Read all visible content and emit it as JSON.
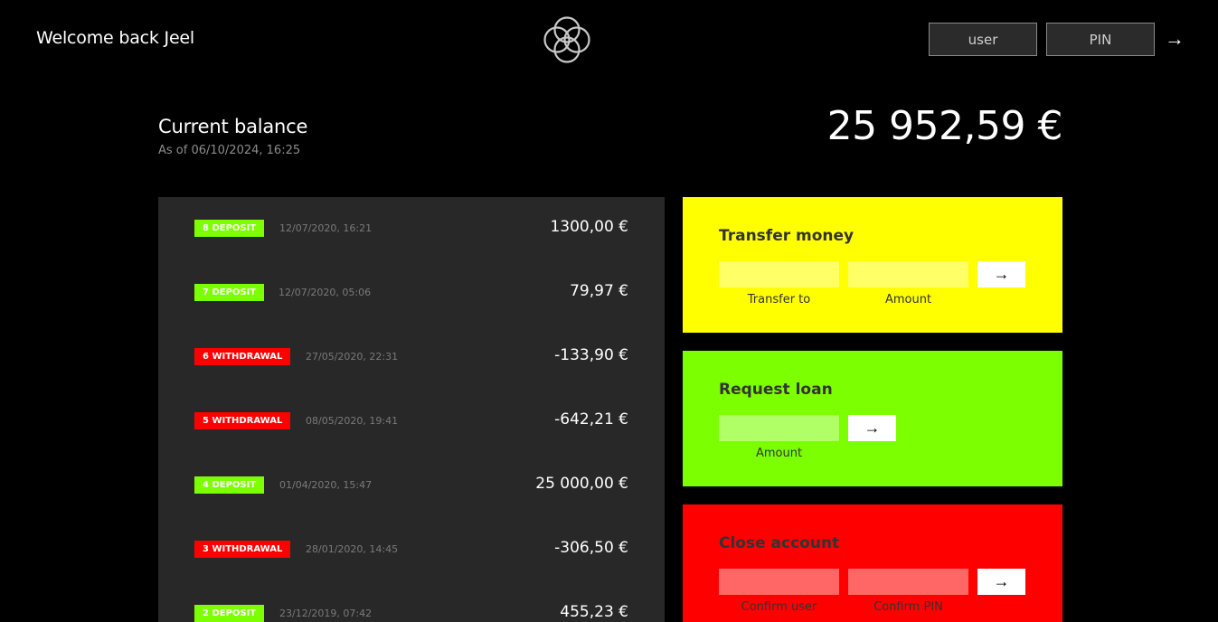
{
  "nav": {
    "welcome": "Welcome back Jeel",
    "logo_icon": "four-circles-logo",
    "login": {
      "user_placeholder": "user",
      "pin_placeholder": "PIN",
      "submit_label": "→"
    }
  },
  "balance": {
    "label": "Current balance",
    "date": "As of 06/10/2024, 16:25",
    "value": "25 952,59 €"
  },
  "movements": [
    {
      "type": "deposit",
      "label": "8 DEPOSIT",
      "date": "12/07/2020, 16:21",
      "value": "1300,00 €"
    },
    {
      "type": "deposit",
      "label": "7 DEPOSIT",
      "date": "12/07/2020, 05:06",
      "value": "79,97 €"
    },
    {
      "type": "withdrawal",
      "label": "6 WITHDRAWAL",
      "date": "27/05/2020, 22:31",
      "value": "-133,90 €"
    },
    {
      "type": "withdrawal",
      "label": "5 WITHDRAWAL",
      "date": "08/05/2020, 19:41",
      "value": "-642,21 €"
    },
    {
      "type": "deposit",
      "label": "4 DEPOSIT",
      "date": "01/04/2020, 15:47",
      "value": "25 000,00 €"
    },
    {
      "type": "withdrawal",
      "label": "3 WITHDRAWAL",
      "date": "28/01/2020, 14:45",
      "value": "-306,50 €"
    },
    {
      "type": "deposit",
      "label": "2 DEPOSIT",
      "date": "23/12/2019, 07:42",
      "value": "455,23 €"
    }
  ],
  "operations": {
    "transfer": {
      "title": "Transfer money",
      "to_label": "Transfer to",
      "amount_label": "Amount",
      "submit_label": "→"
    },
    "loan": {
      "title": "Request loan",
      "amount_label": "Amount",
      "submit_label": "→"
    },
    "close": {
      "title": "Close account",
      "user_label": "Confirm user",
      "pin_label": "Confirm PIN",
      "submit_label": "→"
    }
  },
  "colors": {
    "deposit": "#7cff00",
    "withdrawal": "#ff0000",
    "transfer": "#ffff00",
    "loan": "#7cff00",
    "close": "#ff0000"
  }
}
